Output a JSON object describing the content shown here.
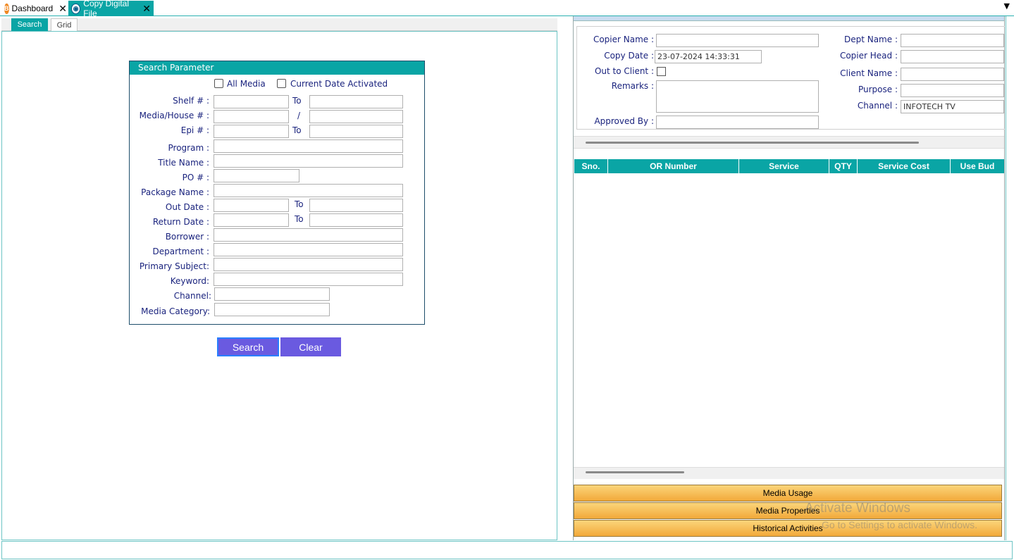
{
  "tabs": {
    "dashboard": "Dashboard",
    "copy_digital_file": "Copy Digital File"
  },
  "subtabs": {
    "search": "Search",
    "grid": "Grid"
  },
  "search_panel": {
    "title": "Search Parameter",
    "all_media": "All Media",
    "current_date_activated": "Current Date Activated",
    "shelf": "Shelf # :",
    "to": "To",
    "slash": "/",
    "media_house": "Media/House # :",
    "epi": "Epi # :",
    "program": "Program :",
    "title_name": "Title Name :",
    "po": "PO # :",
    "package_name": "Package Name :",
    "out_date": "Out Date :",
    "return_date": "Return Date :",
    "borrower": "Borrower :",
    "department": "Department :",
    "primary_subject": "Primary Subject:",
    "keyword": "Keyword:",
    "channel": "Channel:",
    "media_category": "Media Category:"
  },
  "buttons": {
    "search": "Search",
    "clear": "Clear"
  },
  "copy_form": {
    "copier_name": "Copier Name :",
    "copy_date": "Copy  Date :",
    "copy_date_value": "23-07-2024 14:33:31",
    "out_to_client": "Out to Client :",
    "remarks": "Remarks :",
    "approved_by": "Approved By :",
    "dept_name": "Dept Name :",
    "copier_head": "Copier Head :",
    "client_name": "Client Name :",
    "purpose": "Purpose :",
    "channel": "Channel :",
    "channel_value": "INFOTECH TV"
  },
  "grid_columns": [
    "Sno.",
    "OR Number",
    "Service",
    "QTY",
    "Service Cost",
    "Use Bud"
  ],
  "accordion": {
    "media_usage": "Media Usage",
    "media_properties": "Media Properties",
    "historical_activities": "Historical Activities"
  },
  "watermark": {
    "line1": "Activate Windows",
    "line2": "Go to Settings to activate Windows."
  },
  "colors": {
    "teal": "#0aa5a5",
    "button": "#6a5ae0",
    "accordion": "#f2a93a"
  }
}
